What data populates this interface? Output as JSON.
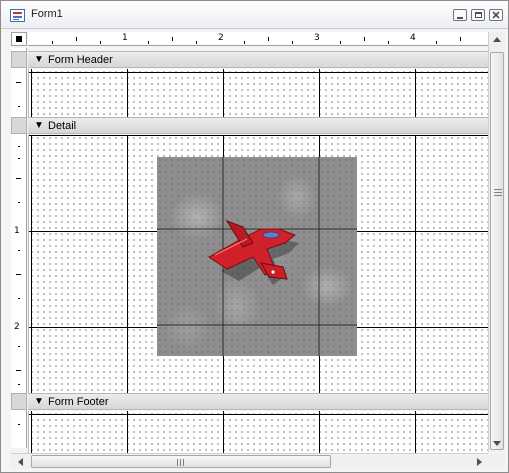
{
  "window": {
    "title": "Form1",
    "icon": "form-icon",
    "controls": [
      "minimize-icon",
      "restore-icon",
      "close-icon"
    ]
  },
  "rulers": {
    "horizontal_labels": [
      "1",
      "2",
      "3",
      "4"
    ],
    "vertical_labels": [
      "1",
      "2"
    ]
  },
  "sections": {
    "header": {
      "label": "Form Header",
      "arrow": "▼"
    },
    "detail": {
      "label": "Detail",
      "arrow": "▼"
    },
    "footer": {
      "label": "Form Footer",
      "arrow": "▼"
    }
  },
  "image_control": {
    "content": "red-airplane-image",
    "background": "#8e8e8e",
    "airplane_color": "#d0202a"
  },
  "colors": {
    "section_bar": "#d6d6d6",
    "grid_line": "#000000",
    "grid_dot": "#6a6a6a"
  }
}
